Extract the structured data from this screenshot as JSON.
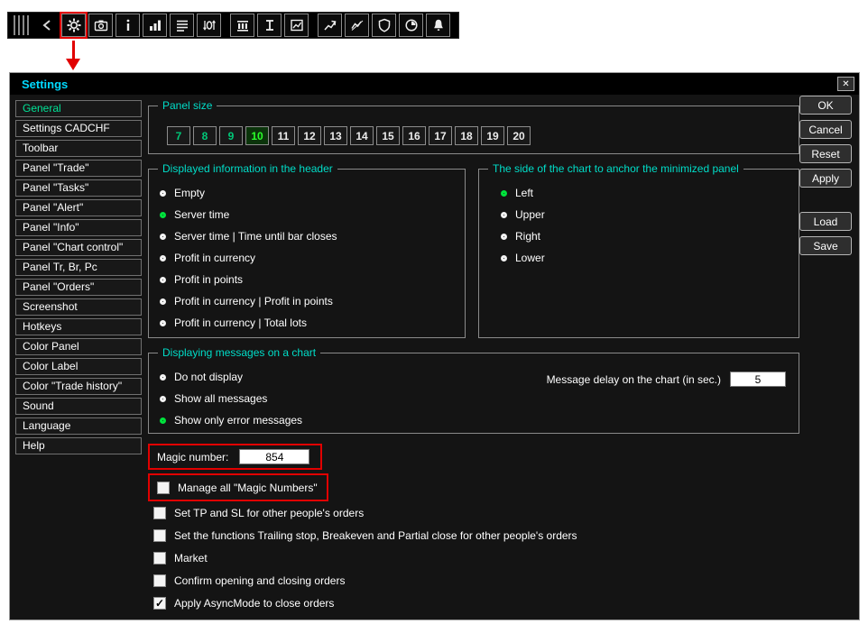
{
  "glyphs": {
    "close": "✕",
    "check": "✓"
  },
  "window": {
    "title": "Settings"
  },
  "toolbar": {
    "icons": [
      "drag-handle",
      "chevron-left",
      "gear",
      "camera",
      "info",
      "bar-chart",
      "list",
      "spread",
      "columns",
      "i-beam",
      "chart-window",
      "trend-arrow",
      "trend-line",
      "shield",
      "pie-clock",
      "bell"
    ]
  },
  "sidebar": {
    "items": [
      "General",
      "Settings CADCHF",
      "Toolbar",
      "Panel \"Trade\"",
      "Panel \"Tasks\"",
      "Panel \"Alert\"",
      "Panel \"Info\"",
      "Panel \"Chart control\"",
      "Panel Tr, Br, Pc",
      "Panel \"Orders\"",
      "Screenshot",
      "Hotkeys",
      "Color Panel",
      "Color Label",
      "Color \"Trade history\"",
      "Sound",
      "Language",
      "Help"
    ],
    "selected": "General"
  },
  "panel_size": {
    "label": "Panel size",
    "options": [
      "7",
      "8",
      "9",
      "10",
      "11",
      "12",
      "13",
      "14",
      "15",
      "16",
      "17",
      "18",
      "19",
      "20"
    ],
    "selected": "10"
  },
  "header_info": {
    "label": "Displayed information in the header",
    "options": [
      {
        "label": "Empty",
        "selected": false
      },
      {
        "label": "Server time",
        "selected": true
      },
      {
        "label": "Server time | Time until bar closes",
        "selected": false
      },
      {
        "label": "Profit in currency",
        "selected": false
      },
      {
        "label": "Profit in points",
        "selected": false
      },
      {
        "label": "Profit in currency | Profit in points",
        "selected": false
      },
      {
        "label": "Profit in currency | Total lots",
        "selected": false
      }
    ]
  },
  "anchor_side": {
    "label": "The side of the chart to anchor the minimized panel",
    "options": [
      {
        "label": "Left",
        "selected": true
      },
      {
        "label": "Upper",
        "selected": false
      },
      {
        "label": "Right",
        "selected": false
      },
      {
        "label": "Lower",
        "selected": false
      }
    ]
  },
  "messages": {
    "label": "Displaying messages on a chart",
    "options": [
      {
        "label": "Do not display",
        "selected": false
      },
      {
        "label": "Show all messages",
        "selected": false
      },
      {
        "label": "Show only error messages",
        "selected": true
      }
    ],
    "delay_label": "Message delay on the chart (in sec.)",
    "delay_value": "5"
  },
  "magic_number": {
    "label": "Magic number:",
    "value": "854"
  },
  "checkboxes": [
    {
      "label": "Manage all \"Magic Numbers\"",
      "checked": false
    },
    {
      "label": "Set TP and SL for other people's orders",
      "checked": false
    },
    {
      "label": "Set the functions Trailing stop, Breakeven and Partial close for other people's orders",
      "checked": false
    },
    {
      "label": "Market",
      "checked": false
    },
    {
      "label": "Confirm opening and closing orders",
      "checked": false
    },
    {
      "label": "Apply AsyncMode to close orders",
      "checked": true
    }
  ],
  "action_buttons": {
    "ok": "OK",
    "cancel": "Cancel",
    "reset": "Reset",
    "apply": "Apply",
    "load": "Load",
    "save": "Save"
  },
  "colors": {
    "title": "#00d9ff",
    "group_label": "#00ddc8",
    "selected_green": "#00e23c",
    "annotation_red": "#e10000"
  }
}
